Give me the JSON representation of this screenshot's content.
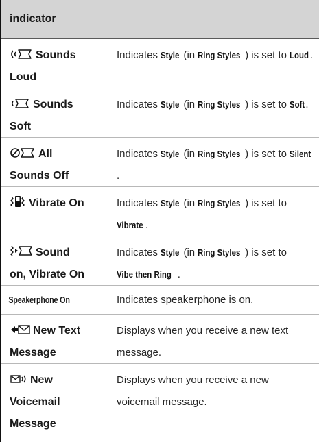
{
  "header": {
    "title": "indicator"
  },
  "rows": [
    {
      "indicator_l1": "Sounds",
      "indicator_l2": "Loud",
      "icon": "ring-loud-icon",
      "desc": {
        "pre": "Indicates ",
        "k1": "Style",
        "mid1": " (in ",
        "k2": "Ring Styles",
        "mid2": ") is set to ",
        "k3": "Loud",
        "post": "."
      }
    },
    {
      "indicator_l1": "Sounds",
      "indicator_l2": "Soft",
      "icon": "ring-soft-icon",
      "desc": {
        "pre": "Indicates ",
        "k1": "Style",
        "mid1": " (in ",
        "k2": "Ring Styles",
        "mid2": ") is set to ",
        "k3": "Soft",
        "post": "."
      }
    },
    {
      "indicator_l1": "All",
      "indicator_l2": "Sounds Off",
      "icon": "sounds-off-icon",
      "desc": {
        "pre": "Indicates ",
        "k1": "Style",
        "mid1": " (in ",
        "k2": "Ring Styles",
        "mid2": ") is set to ",
        "k3": "Silent",
        "post": "."
      }
    },
    {
      "indicator_l1": "Vibrate On",
      "icon": "vibrate-icon",
      "desc": {
        "pre": "Indicates ",
        "k1": "Style",
        "mid1": " (in ",
        "k2": "Ring Styles",
        "mid2": ") is set to ",
        "k3": "Vibrate",
        "post": "."
      }
    },
    {
      "indicator_l1": "Sound",
      "indicator_l2": "on, Vibrate On",
      "icon": "vibrate-then-ring-icon",
      "desc": {
        "pre": "Indicates ",
        "k1": "Style",
        "mid1": " (in ",
        "k2": "Ring Styles",
        "mid2": ") is set to ",
        "k3": "Vibe then Ring",
        "post": "."
      }
    },
    {
      "indicator_l1": "Speakerphone On",
      "desc_plain": "Indicates speakerphone is on."
    },
    {
      "indicator_l1": "New Text",
      "indicator_l2": "Message",
      "icon": "new-text-message-icon",
      "desc_plain": "Displays when you receive a new text message."
    },
    {
      "indicator_l1": "New",
      "indicator_l2": "Voicemail",
      "indicator_l3": "Message",
      "icon": "voicemail-icon",
      "desc_plain": "Displays when you receive a new voicemail message."
    }
  ]
}
